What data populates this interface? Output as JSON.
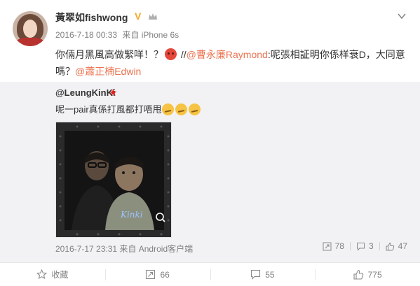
{
  "post": {
    "username": "黃翠如fishwong",
    "verified_badge": "V",
    "timestamp": "2016-7-18 00:33",
    "source": "来自 iPhone 6s",
    "text_part1": "你倆月黑風高做緊咩！？",
    "text_separator": " //",
    "mention_1": "@曹永廉Raymond",
    "text_part2": ":呢張相証明你係样衰D，大同意嗎？",
    "mention_2": "@蕭正楠Edwin"
  },
  "repost": {
    "author": "@LeungKinKi",
    "text": "呢一pair真係打風都打唔甩",
    "photo_watermark": "Kinki",
    "timestamp": "2016-7-17 23:31",
    "source": "来自 Android客户端",
    "reposts": "78",
    "comments": "3",
    "likes": "47"
  },
  "actions": {
    "favorite_label": "收藏",
    "repost_count": "66",
    "comment_count": "55",
    "like_count": "775"
  },
  "colors": {
    "mention": "#eb7350",
    "meta": "#808080",
    "repost_bg": "#f2f2f5",
    "badge": "#f5a623"
  },
  "icons": [
    "crown-icon",
    "chevron-down-icon",
    "angry-emoji-icon",
    "smirk-emoji-icon",
    "zoom-icon",
    "repost-icon",
    "comment-icon",
    "like-icon",
    "favorite-icon"
  ]
}
